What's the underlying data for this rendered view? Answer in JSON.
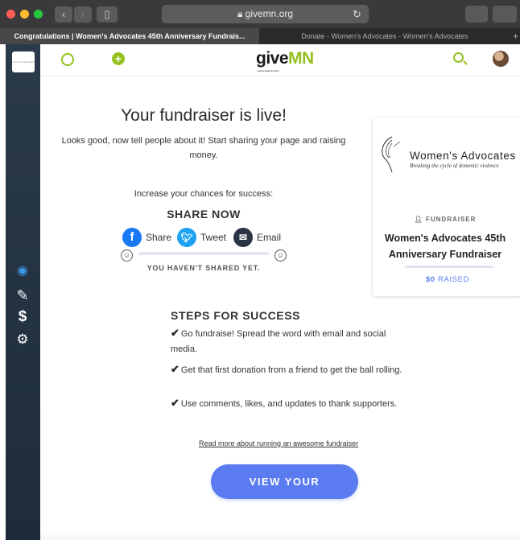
{
  "browser": {
    "url": "givemn.org",
    "tabs": [
      {
        "label": "Congratulations | Women's Advocates 45th Anniversary Fundrais...",
        "active": true
      },
      {
        "label": "Donate - Women's Advocates - Women's Advocates",
        "active": false
      }
    ],
    "new_tab_glyph": "+"
  },
  "site": {
    "logo_part1": "give",
    "logo_part2": "MN",
    "logo_tagline": "Ignite Generosity | Grow Giving",
    "accent_color": "#94c11f",
    "button_color": "#5b7cf0"
  },
  "sidebar": {
    "org_logo_text": "Women's Advocates",
    "icons": [
      "eye-icon",
      "pencil-icon",
      "dollar-icon",
      "gears-icon"
    ]
  },
  "main": {
    "title": "Your fundraiser is live!",
    "subtitle": "Looks good, now tell people about it! Start sharing your page and raising money.",
    "increase_text": "Increase your chances for success:",
    "share_now": "SHARE NOW",
    "share_buttons": {
      "facebook": "Share",
      "twitter": "Tweet",
      "email": "Email"
    },
    "share_progress": 0,
    "not_shared": "YOU HAVEN'T SHARED YET."
  },
  "card": {
    "org_name": "Women's Advocates",
    "org_tagline": "Breaking the cycle of domestic violence",
    "label": "FUNDRAISER",
    "title": "Women's Advocates 45th Anniversary Fundraiser",
    "raised_amount": "$0",
    "raised_label": "RAISED",
    "raised_progress": 0
  },
  "steps": {
    "title": "STEPS FOR SUCCESS",
    "items": [
      "Go fundraise! Spread the word with email and social media.",
      "Get that first donation from a friend to get the ball rolling.",
      "Use comments, likes, and updates to thank supporters."
    ],
    "read_more": "Read more about running an awesome fundraiser",
    "view_button": "VIEW YOUR FUNDRAISER"
  }
}
